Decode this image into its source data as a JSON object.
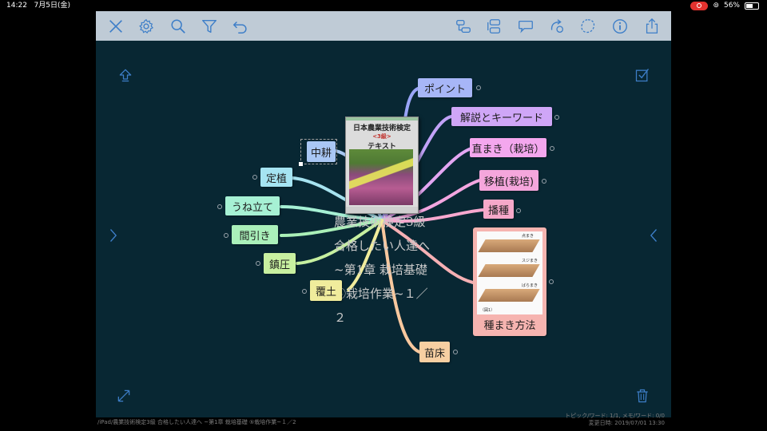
{
  "status": {
    "time": "14:22",
    "date": "7月5日(金)",
    "battery": "56%",
    "battery_level": 0.56
  },
  "colors": {
    "toolbar": "#bfcbd6",
    "canvas": "#082733",
    "icon": "#3d7ec8"
  },
  "toolbar": {
    "left_icons": [
      "close-icon",
      "gear-icon",
      "search-icon",
      "filter-icon",
      "undo-icon"
    ],
    "right_icons": [
      "add-subtopic-icon",
      "add-sibling-icon",
      "callout-icon",
      "link-icon",
      "boundary-icon",
      "info-icon",
      "share-icon"
    ]
  },
  "map": {
    "center_lines": [
      "農業技術検定3級",
      "合格したい人達へ",
      "~第1章 栽培基礎",
      "⑤栽培作業~１／",
      "２"
    ],
    "book": {
      "series": "日本農業技術検定",
      "grade": "<3級>",
      "subtitle": "テキスト"
    },
    "right_topics": [
      "ポイント",
      "解説とキーワード",
      "直まき（栽培）",
      "移植(栽培)",
      "播種",
      "種まき方法",
      "苗床"
    ],
    "left_topics": [
      "中耕",
      "定植",
      "うね立て",
      "間引き",
      "鎮圧",
      "覆土"
    ],
    "seed_card": {
      "labels": [
        "点まき",
        "スジまき",
        "ばらまき"
      ],
      "caption": "（図1）"
    }
  },
  "footer": {
    "path": "/iPad/農業技術検定3級 合格したい人達へ ~第1章 栽培基礎 ⑤栽培作業~１／2",
    "stats": "トピック/ワード: 1/1, メモ/ワード: 0/0",
    "modified": "変更日時: 2019/07/01 13:30"
  }
}
